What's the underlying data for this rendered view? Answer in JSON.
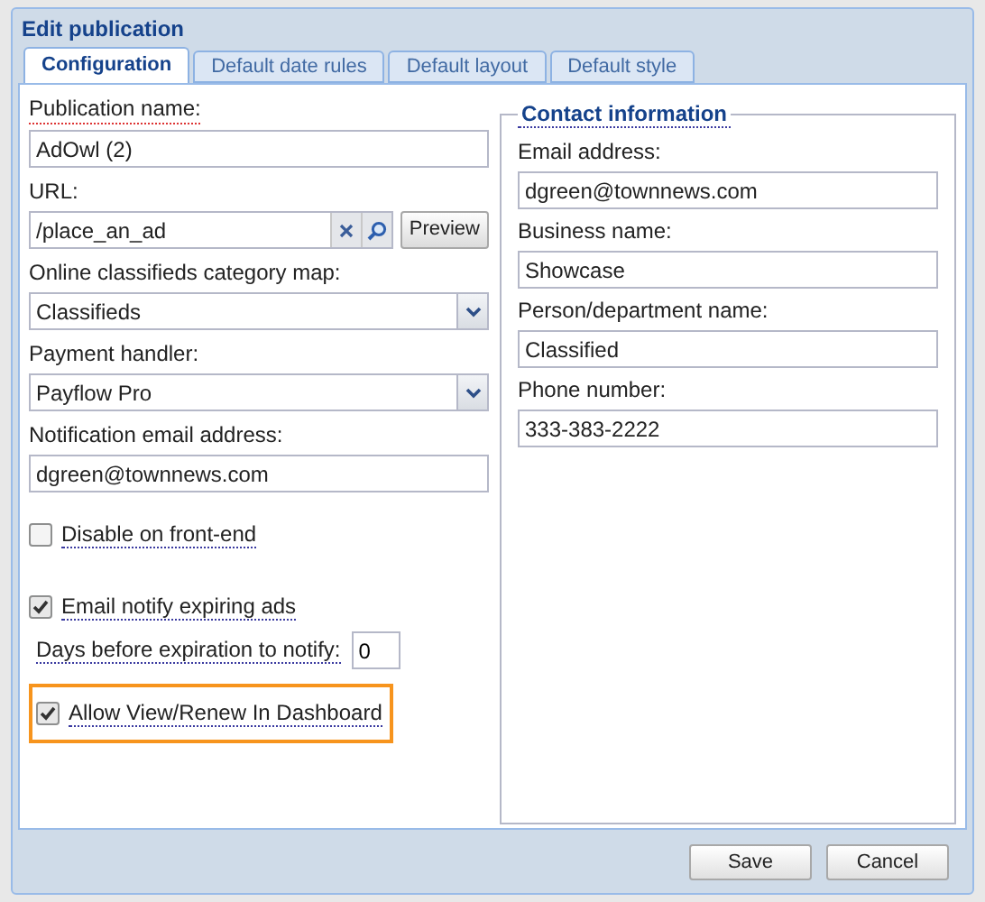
{
  "window": {
    "title": "Edit publication"
  },
  "tabs": [
    {
      "label": "Configuration",
      "selected": true
    },
    {
      "label": "Default date rules",
      "selected": false
    },
    {
      "label": "Default layout",
      "selected": false
    },
    {
      "label": "Default style",
      "selected": false
    }
  ],
  "fields": [
    {
      "kind": "text",
      "label": "Publication name:",
      "value": "AdOwl (2)",
      "required": true
    },
    {
      "kind": "url",
      "label": "URL:",
      "value": "/place_an_ad",
      "button": "Preview",
      "required": false
    },
    {
      "kind": "select",
      "label": "Online classifieds category map:",
      "value": "Classifieds",
      "required": false
    },
    {
      "kind": "select",
      "label": "Payment handler:",
      "value": "Payflow Pro",
      "required": false
    },
    {
      "kind": "text",
      "label": "Notification email address:",
      "value": "dgreen@townnews.com",
      "required": false
    }
  ],
  "disable_option": {
    "label": "Disable on front-end",
    "checked": false
  },
  "notify_option": {
    "label": "Email notify expiring ads",
    "checked": true
  },
  "days_field": {
    "label": "Days before expiration to notify:",
    "value": "0"
  },
  "dashboard_option": {
    "label": "Allow View/Renew In Dashboard",
    "checked": true,
    "highlighted": true
  },
  "contact": {
    "legend": "Contact information",
    "fields": [
      {
        "label": "Email address:",
        "value": "dgreen@townnews.com"
      },
      {
        "label": "Business name:",
        "value": "Showcase"
      },
      {
        "label": "Person/department name:",
        "value": "Classified"
      },
      {
        "label": "Phone number:",
        "value": "333-383-2222"
      }
    ]
  },
  "buttons": [
    "Save",
    "Cancel"
  ]
}
